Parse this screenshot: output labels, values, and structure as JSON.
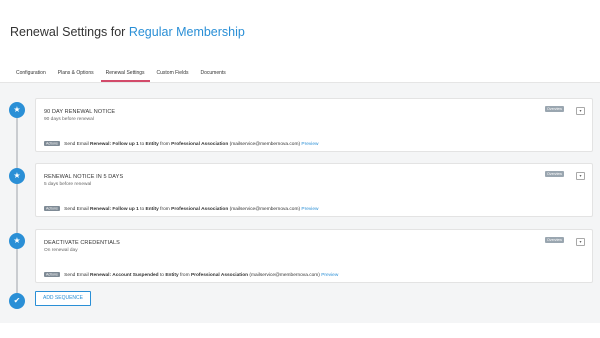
{
  "header": {
    "title_prefix": "Renewal Settings for",
    "title_link": "Regular Membership"
  },
  "tabs": [
    {
      "label": "Configuration",
      "active": false
    },
    {
      "label": "Plans & Options",
      "active": false
    },
    {
      "label": "Renewal Settings",
      "active": true
    },
    {
      "label": "Custom Fields",
      "active": false
    },
    {
      "label": "Documents",
      "active": false
    }
  ],
  "icons": {
    "step_icon": "star-icon",
    "final_icon": "checkmark-icon",
    "collapse_icon": "chevron-down-icon"
  },
  "colors": {
    "accent": "#2a8fd6",
    "tab_underline": "#d24a6a"
  },
  "sequences": [
    {
      "title": "90 DAY RENEWAL NOTICE",
      "subtitle": "90 days before renewal",
      "badge": "Overview",
      "action_badge": "Actions",
      "action_prefix": "Send Email",
      "action_bold_1": "Renewal: Follow up 1",
      "action_mid": "to",
      "action_bold_2": "Entity",
      "action_from": "from",
      "action_bold_3": "Professional Association",
      "action_email": "(mailservice@membernova.com)",
      "preview": "Preview"
    },
    {
      "title": "RENEWAL NOTICE IN 5 DAYS",
      "subtitle": "5 days before renewal",
      "badge": "Overview",
      "action_badge": "Actions",
      "action_prefix": "Send Email",
      "action_bold_1": "Renewal: Follow up 1",
      "action_mid": "to",
      "action_bold_2": "Entity",
      "action_from": "from",
      "action_bold_3": "Professional Association",
      "action_email": "(mailservice@membernova.com)",
      "preview": "Preview"
    },
    {
      "title": "DEACTIVATE CREDENTIALS",
      "subtitle": "On renewal day",
      "badge": "Overview",
      "action_badge": "Actions",
      "action_prefix": "Send Email",
      "action_bold_1": "Renewal: Account Suspended",
      "action_mid": "to",
      "action_bold_2": "Entity",
      "action_from": "from",
      "action_bold_3": "Professional Association",
      "action_email": "(mailservice@membernova.com)",
      "preview": "Preview"
    }
  ],
  "add_sequence_label": "ADD SEQUENCE"
}
